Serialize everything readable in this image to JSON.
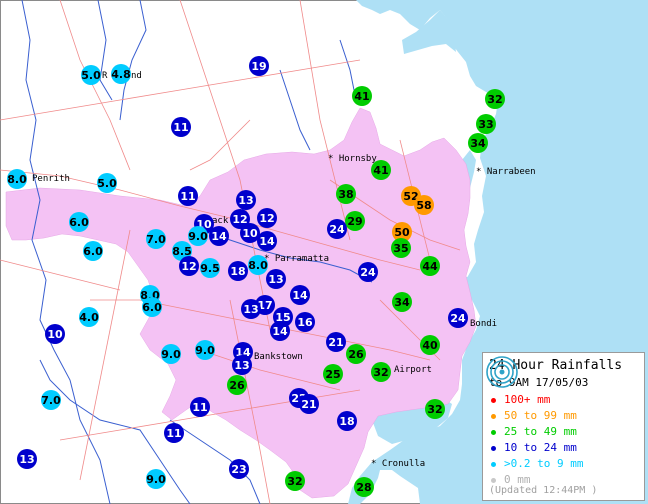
{
  "legend": {
    "title": "24 Hour Rainfalls",
    "subtitle": "to 9AM 17/05/03",
    "items": [
      {
        "label": "100+ mm",
        "color": "#ff0000"
      },
      {
        "label": "50 to 99 mm",
        "color": "#ff9900"
      },
      {
        "label": "25 to 49 mm",
        "color": "#00cc00"
      },
      {
        "label": "10 to 24 mm",
        "color": "#0000cc"
      },
      {
        "label": ">0.2 to 9 mm",
        "color": "#00ccff"
      },
      {
        "label": "0 mm",
        "color": "#c8c8c8"
      }
    ],
    "updated": "(Updated 12:44PM )"
  },
  "places": [
    {
      "id": "penrith",
      "label": "Penrith"
    },
    {
      "id": "hornsby",
      "label": "* Hornsby"
    },
    {
      "id": "narrabeen",
      "label": "* Narrabeen"
    },
    {
      "id": "parramatta",
      "label": "* Parramatta"
    },
    {
      "id": "blacktown",
      "label": "ack"
    },
    {
      "id": "richmond",
      "label": "R"
    },
    {
      "id": "richmond2",
      "label": "nd"
    },
    {
      "id": "bankstown",
      "label": "Bankstown"
    },
    {
      "id": "airport",
      "label": "Airport"
    },
    {
      "id": "bondi",
      "label": "Bondi"
    },
    {
      "id": "cronulla",
      "label": "* Cronulla"
    }
  ],
  "stations": [
    {
      "v": "5.0",
      "c": "#00ccff"
    },
    {
      "v": "4.8",
      "c": "#00ccff"
    },
    {
      "v": "19",
      "c": "#0000cc"
    },
    {
      "v": "41",
      "c": "#00cc00"
    },
    {
      "v": "32",
      "c": "#00cc00"
    },
    {
      "v": "11",
      "c": "#0000cc"
    },
    {
      "v": "33",
      "c": "#00cc00"
    },
    {
      "v": "34",
      "c": "#00cc00"
    },
    {
      "v": "8.0",
      "c": "#00ccff"
    },
    {
      "v": "5.0",
      "c": "#00ccff"
    },
    {
      "v": "41",
      "c": "#00cc00"
    },
    {
      "v": "11",
      "c": "#0000cc"
    },
    {
      "v": "13",
      "c": "#0000cc"
    },
    {
      "v": "38",
      "c": "#00cc00"
    },
    {
      "v": "52",
      "c": "#ff9900"
    },
    {
      "v": "58",
      "c": "#ff9900"
    },
    {
      "v": "12",
      "c": "#0000cc"
    },
    {
      "v": "12",
      "c": "#0000cc"
    },
    {
      "v": "10",
      "c": "#0000cc"
    },
    {
      "v": "29",
      "c": "#00cc00"
    },
    {
      "v": "6.0",
      "c": "#00ccff"
    },
    {
      "v": "10",
      "c": "#0000cc"
    },
    {
      "v": "9.0",
      "c": "#00ccff"
    },
    {
      "v": "14",
      "c": "#0000cc"
    },
    {
      "v": "24",
      "c": "#0000cc"
    },
    {
      "v": "50",
      "c": "#ff9900"
    },
    {
      "v": "7.0",
      "c": "#00ccff"
    },
    {
      "v": "14",
      "c": "#0000cc"
    },
    {
      "v": "35",
      "c": "#00cc00"
    },
    {
      "v": "6.0",
      "c": "#00ccff"
    },
    {
      "v": "8.5",
      "c": "#00ccff"
    },
    {
      "v": "12",
      "c": "#0000cc"
    },
    {
      "v": "9.5",
      "c": "#00ccff"
    },
    {
      "v": "18",
      "c": "#0000cc"
    },
    {
      "v": "8.0",
      "c": "#00ccff"
    },
    {
      "v": "44",
      "c": "#00cc00"
    },
    {
      "v": "24",
      "c": "#0000cc"
    },
    {
      "v": "13",
      "c": "#0000cc"
    },
    {
      "v": "8.0",
      "c": "#00ccff"
    },
    {
      "v": "6.0",
      "c": "#00ccff"
    },
    {
      "v": "14",
      "c": "#0000cc"
    },
    {
      "v": "34",
      "c": "#00cc00"
    },
    {
      "v": "17",
      "c": "#0000cc"
    },
    {
      "v": "13",
      "c": "#0000cc"
    },
    {
      "v": "4.0",
      "c": "#00ccff"
    },
    {
      "v": "15",
      "c": "#0000cc"
    },
    {
      "v": "16",
      "c": "#0000cc"
    },
    {
      "v": "24",
      "c": "#0000cc"
    },
    {
      "v": "14",
      "c": "#0000cc"
    },
    {
      "v": "10",
      "c": "#0000cc"
    },
    {
      "v": "21",
      "c": "#0000cc"
    },
    {
      "v": "40",
      "c": "#00cc00"
    },
    {
      "v": "9.0",
      "c": "#00ccff"
    },
    {
      "v": "9.0",
      "c": "#00ccff"
    },
    {
      "v": "14",
      "c": "#0000cc"
    },
    {
      "v": "26",
      "c": "#00cc00"
    },
    {
      "v": "13",
      "c": "#0000cc"
    },
    {
      "v": "25",
      "c": "#00cc00"
    },
    {
      "v": "32",
      "c": "#00cc00"
    },
    {
      "v": "26",
      "c": "#00cc00"
    },
    {
      "v": "7.0",
      "c": "#00ccff"
    },
    {
      "v": "22",
      "c": "#0000cc"
    },
    {
      "v": "21",
      "c": "#0000cc"
    },
    {
      "v": "11",
      "c": "#0000cc"
    },
    {
      "v": "32",
      "c": "#00cc00"
    },
    {
      "v": "18",
      "c": "#0000cc"
    },
    {
      "v": "11",
      "c": "#0000cc"
    },
    {
      "v": "13",
      "c": "#0000cc"
    },
    {
      "v": "23",
      "c": "#0000cc"
    },
    {
      "v": "9.0",
      "c": "#00ccff"
    },
    {
      "v": "32",
      "c": "#00cc00"
    },
    {
      "v": "28",
      "c": "#00cc00"
    }
  ]
}
